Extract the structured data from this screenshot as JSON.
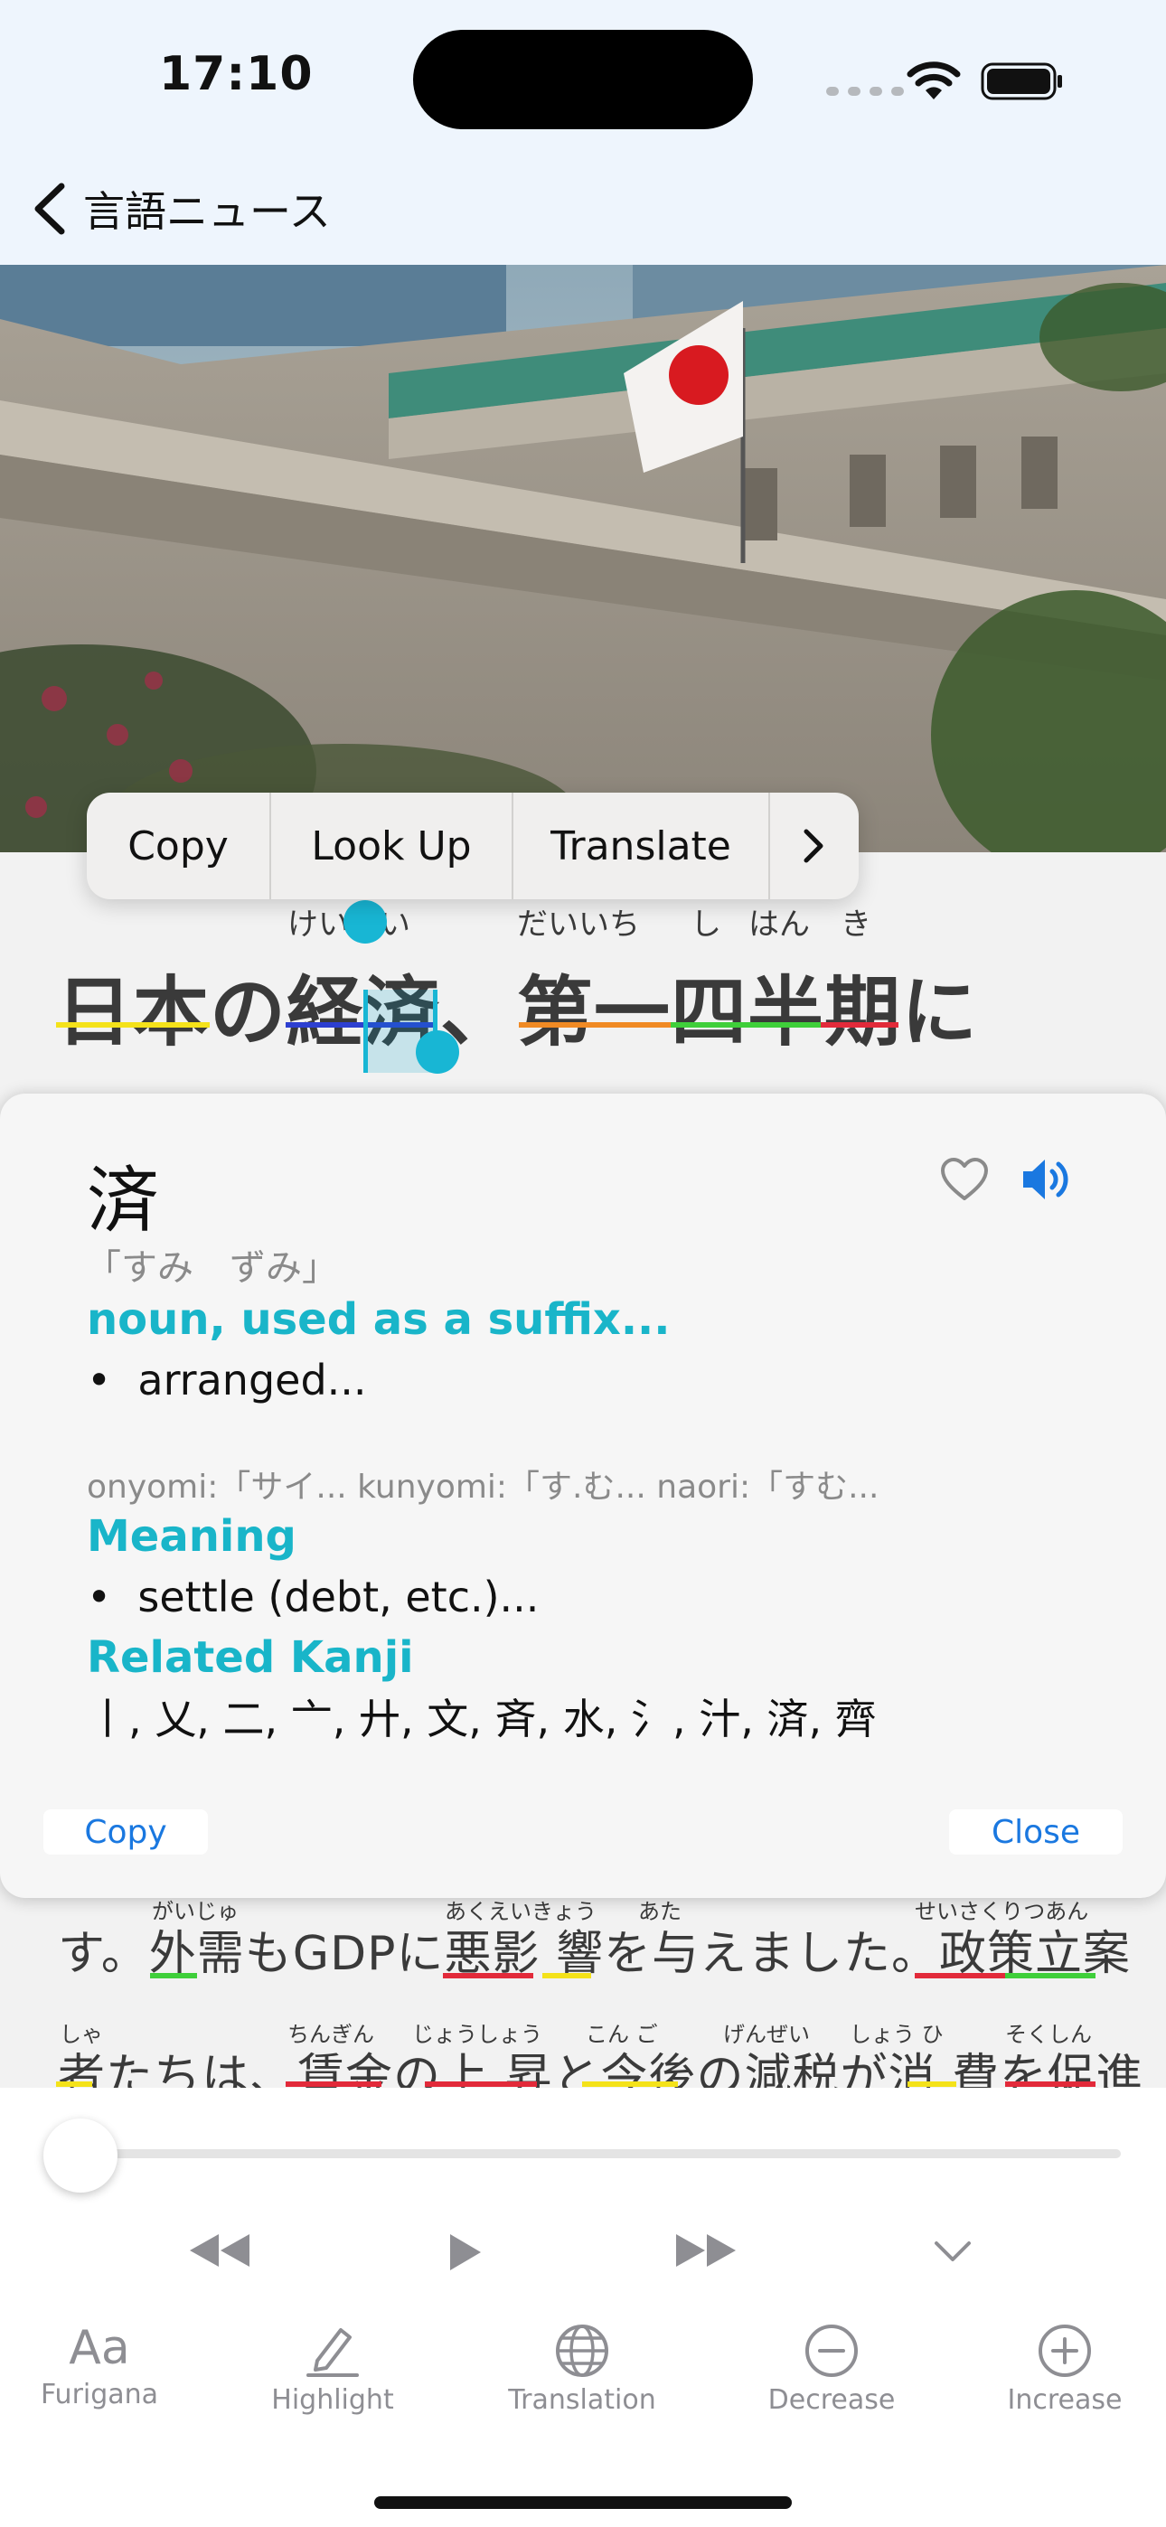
{
  "status": {
    "time": "17:10"
  },
  "nav": {
    "back_label": "言語ニュース"
  },
  "context_menu": {
    "items": [
      "Copy",
      "Look Up",
      "Translate"
    ]
  },
  "headline": {
    "text": "日本の経済、第一四半期に",
    "furigana": {
      "keizai": "けいざい",
      "daiichi": "だいいち",
      "shi": "し",
      "han": "はん",
      "ki": "き"
    }
  },
  "article_lines": [
    {
      "text": "す。外需もGDPに悪影 響を与えました。政策立案",
      "furigana": [
        "がいじゅ",
        "あくえいきょう",
        "あた",
        "せいさくりつあん"
      ]
    },
    {
      "text": "者たちは、賃金の上 昇と今後の減税が消 費を促進",
      "furigana": [
        "しゃ",
        "ちんぎん",
        "じょうしょう",
        "こん ご",
        "げんぜい",
        "しょう ひ",
        "そくしん"
      ]
    }
  ],
  "dictionary": {
    "kanji": "済",
    "reading": "「すみ　ずみ」",
    "part_of_speech": "noun, used as a suffix...",
    "definition": "arranged...",
    "readings_line": "onyomi:「サイ...   kunyomi:「す.む...   naori:「すむ...",
    "meaning_heading": "Meaning",
    "meaning": "settle (debt, etc.)...",
    "related_heading": "Related Kanji",
    "related_kanji": "丨, 乂, 二, 亠, 廾, 文, 斉, 水, 氵, 汁, 済, 齊",
    "copy_label": "Copy",
    "close_label": "Close"
  },
  "player": {
    "progress": 0.0
  },
  "tabs": [
    {
      "icon": "Aa",
      "label": "Furigana"
    },
    {
      "icon": "pencil-icon",
      "label": "Highlight"
    },
    {
      "icon": "globe-icon",
      "label": "Translation"
    },
    {
      "icon": "minus-circle-icon",
      "label": "Decrease"
    },
    {
      "icon": "plus-circle-icon",
      "label": "Increase"
    }
  ],
  "colors": {
    "accent": "#19b5c9",
    "link_blue": "#1a78e0",
    "underline_yellow": "#f4e21a",
    "underline_blue": "#2d3fd0",
    "underline_orange": "#f08a24",
    "underline_green": "#3fcf3a",
    "underline_red": "#e22a3a"
  }
}
